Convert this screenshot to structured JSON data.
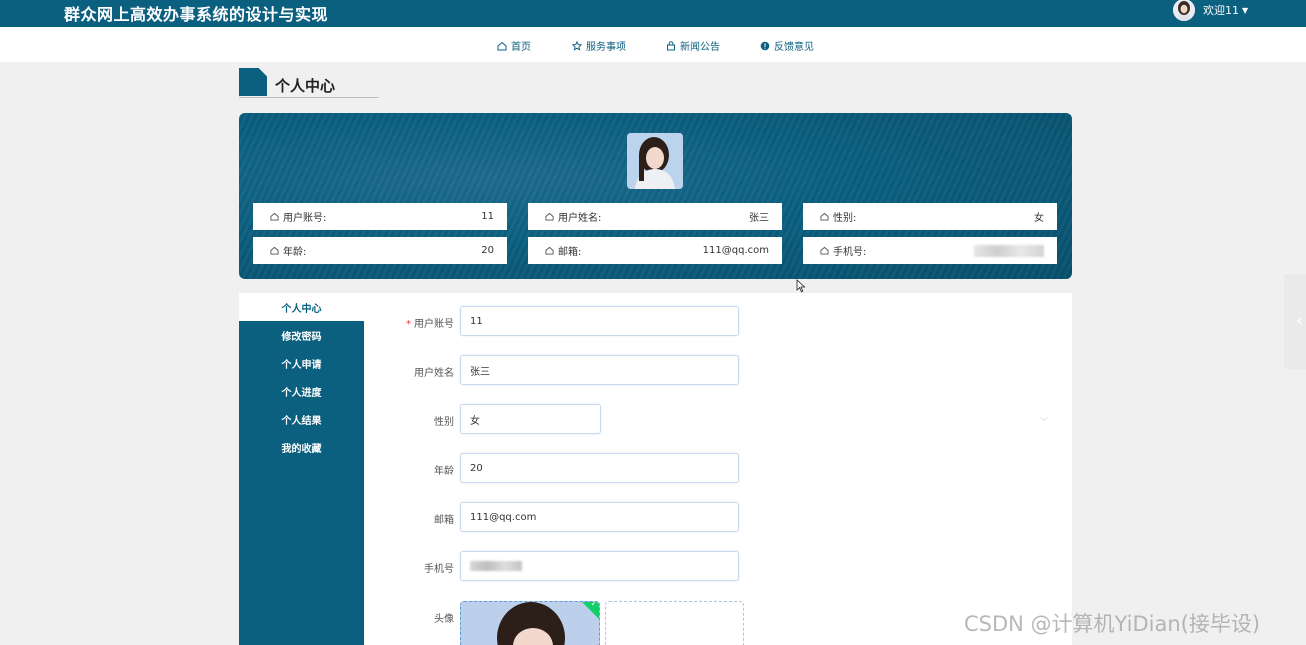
{
  "header": {
    "site_title": "群众网上高效办事系统的设计与实现",
    "welcome": "欢迎11",
    "caret": "▼"
  },
  "nav": {
    "items": [
      {
        "label": "首页",
        "icon": "home-icon"
      },
      {
        "label": "服务事项",
        "icon": "star-icon"
      },
      {
        "label": "新闻公告",
        "icon": "bag-icon"
      },
      {
        "label": "反馈意见",
        "icon": "info-icon"
      }
    ]
  },
  "section": {
    "title": "个人中心"
  },
  "profile_card": {
    "fields": [
      {
        "label": "用户账号:",
        "value": "11"
      },
      {
        "label": "用户姓名:",
        "value": "张三"
      },
      {
        "label": "性别:",
        "value": "女"
      },
      {
        "label": "年龄:",
        "value": "20"
      },
      {
        "label": "邮箱:",
        "value": "111@qq.com"
      },
      {
        "label": "手机号:",
        "value": ""
      }
    ]
  },
  "sidebar": {
    "items": [
      {
        "label": "个人中心",
        "active": true
      },
      {
        "label": "修改密码",
        "active": false
      },
      {
        "label": "个人申请",
        "active": false
      },
      {
        "label": "个人进度",
        "active": false
      },
      {
        "label": "个人结果",
        "active": false
      },
      {
        "label": "我的收藏",
        "active": false
      }
    ]
  },
  "form": {
    "required_mark": "*",
    "fields": [
      {
        "label": "用户账号",
        "value": "11",
        "required": true
      },
      {
        "label": "用户姓名",
        "value": "张三",
        "required": false
      },
      {
        "label": "性别",
        "value": "女",
        "required": false
      },
      {
        "label": "年龄",
        "value": "20",
        "required": false
      },
      {
        "label": "邮箱",
        "value": "111@qq.com",
        "required": false
      },
      {
        "label": "手机号",
        "value": "",
        "required": false
      },
      {
        "label": "头像",
        "value": "",
        "required": false
      }
    ],
    "select_caret": "⌵",
    "upload_check": "✓"
  },
  "watermark": "CSDN @计算机YiDian(接毕设)",
  "colors": {
    "primary": "#0b5f7f",
    "success": "#13ce66",
    "required": "#ee3333"
  }
}
